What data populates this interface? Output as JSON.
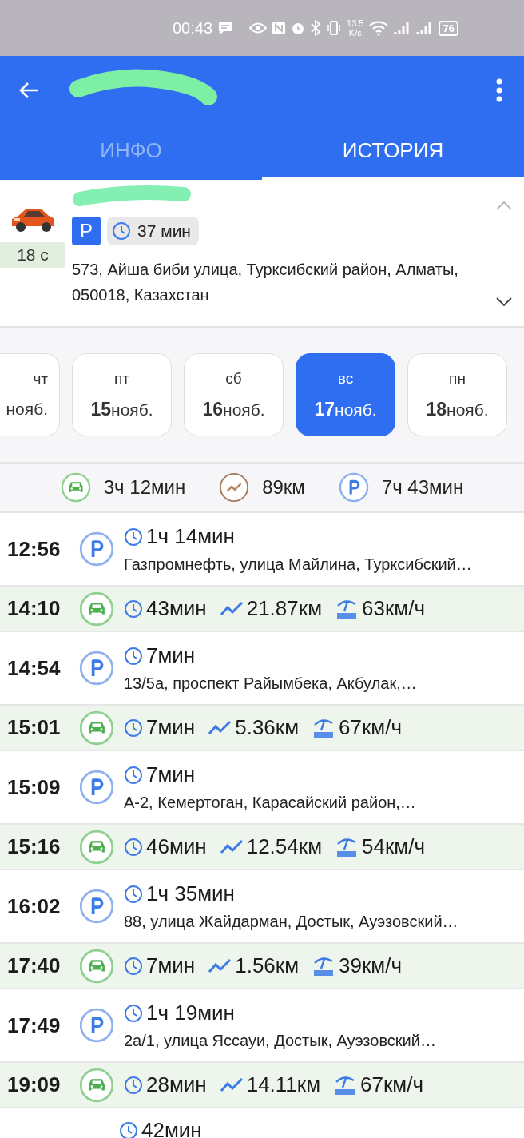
{
  "status_bar": {
    "time": "00:43",
    "speed_value": "13.5",
    "speed_unit": "K/s",
    "battery": "76"
  },
  "tabs": [
    {
      "label": "ИНФО",
      "selected": false
    },
    {
      "label": "ИСТОРИЯ",
      "selected": true
    }
  ],
  "vehicle": {
    "ago": "18 с",
    "state_badge": "P",
    "duration": "37 мин",
    "address": "573, Айша биби улица, Турксибский район, Алматы, 050018, Казахстан",
    "expanded": false
  },
  "days": [
    {
      "weekday": "чт",
      "month": "нояб.",
      "selected": false
    },
    {
      "weekday": "пт",
      "day": "15",
      "month": "нояб.",
      "selected": false
    },
    {
      "weekday": "сб",
      "day": "16",
      "month": "нояб.",
      "selected": false
    },
    {
      "weekday": "вс",
      "day": "17",
      "month": "нояб.",
      "selected": true
    },
    {
      "weekday": "пн",
      "day": "18",
      "month": "нояб.",
      "selected": false
    }
  ],
  "summary": {
    "driving": "3ч 12мин",
    "distance": "89км",
    "parking": "7ч 43мин"
  },
  "rows": [
    {
      "kind": "parking",
      "time": "12:56",
      "duration": "1ч 14мин",
      "address": "Газпромнефть, улица Майлина, Турксибский…"
    },
    {
      "kind": "drive",
      "time": "14:10",
      "duration": "43мин",
      "distance": "21.87км",
      "max_speed": "63км/ч"
    },
    {
      "kind": "parking",
      "time": "14:54",
      "duration": "7мин",
      "address": "13/5а, проспект Райымбека, Акбулак,…"
    },
    {
      "kind": "drive",
      "time": "15:01",
      "duration": "7мин",
      "distance": "5.36км",
      "max_speed": "67км/ч"
    },
    {
      "kind": "parking",
      "time": "15:09",
      "duration": "7мин",
      "address": "А-2, Кемертоган, Карасайский район,…"
    },
    {
      "kind": "drive",
      "time": "15:16",
      "duration": "46мин",
      "distance": "12.54км",
      "max_speed": "54км/ч"
    },
    {
      "kind": "parking",
      "time": "16:02",
      "duration": "1ч 35мин",
      "address": "88, улица Жайдарман, Достык, Ауэзовский…"
    },
    {
      "kind": "drive",
      "time": "17:40",
      "duration": "7мин",
      "distance": "1.56км",
      "max_speed": "39км/ч"
    },
    {
      "kind": "parking",
      "time": "17:49",
      "duration": "1ч 19мин",
      "address": "2а/1, улица Яссауи, Достык, Ауэзовский…"
    },
    {
      "kind": "drive",
      "time": "19:09",
      "duration": "28мин",
      "distance": "14.11км",
      "max_speed": "67км/ч"
    },
    {
      "kind": "parking",
      "duration": "42мин"
    }
  ]
}
